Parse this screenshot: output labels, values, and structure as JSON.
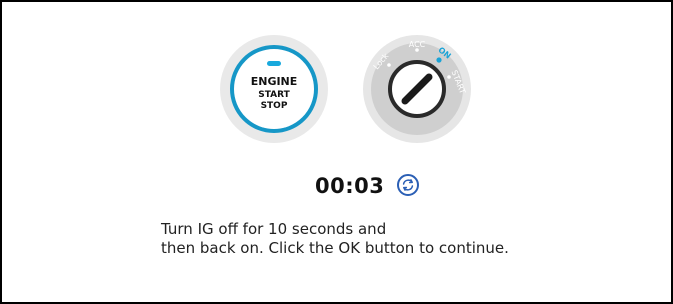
{
  "engine_button": {
    "line1": "ENGINE",
    "line2": "START",
    "line3": "STOP",
    "led_color": "#19a9dd",
    "ring_color": "#1697c7"
  },
  "ignition": {
    "labels": {
      "lock": "Lock",
      "acc": "ACC",
      "on": "ON",
      "start": "START"
    },
    "active_position": "ON",
    "active_color": "#1aa3d6"
  },
  "timer": {
    "value": "00:03",
    "refresh_icon": "refresh-icon"
  },
  "instructions": {
    "line1": "Turn IG off for 10 seconds and",
    "line2": "then back on. Click the OK button to continue."
  }
}
